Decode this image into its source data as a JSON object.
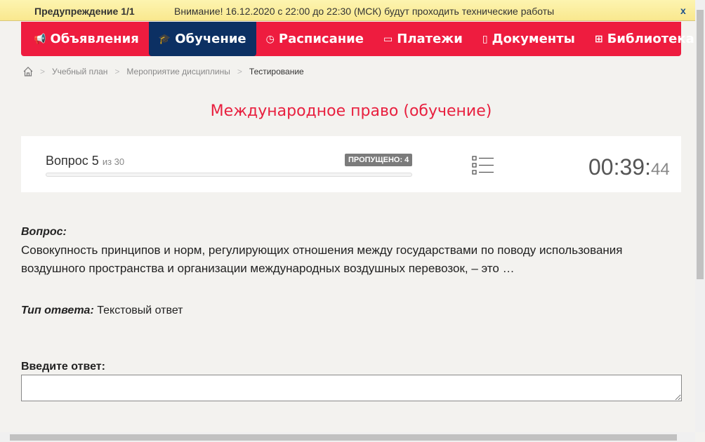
{
  "warning": {
    "title": "Предупреждение 1/1",
    "message": "Внимание! 16.12.2020 с 22:00 до 22:30 (МСК) будут проходить технические работы",
    "close": "x"
  },
  "nav": [
    {
      "label": "Объявления",
      "icon": "megaphone-icon",
      "glyph": "📢"
    },
    {
      "label": "Обучение",
      "icon": "graduation-cap-icon",
      "glyph": "🎓",
      "active": true
    },
    {
      "label": "Расписание",
      "icon": "clock-icon",
      "glyph": "◷"
    },
    {
      "label": "Платежи",
      "icon": "money-icon",
      "glyph": "▭"
    },
    {
      "label": "Документы",
      "icon": "document-icon",
      "glyph": "▯"
    },
    {
      "label": "Библиотека",
      "icon": "book-icon",
      "glyph": "⊞",
      "chevron": "⌄"
    }
  ],
  "breadcrumb": [
    "Учебный план",
    "Мероприятие дисциплины",
    "Тестирование"
  ],
  "page_title": "Международное право (обучение)",
  "test": {
    "question_label": "Вопрос 5",
    "of_label": "из 30",
    "progress": 0,
    "skipped": "ПРОПУЩЕНО: 4",
    "timer_main": "00:39:",
    "timer_sec": "44"
  },
  "question": {
    "heading": "Вопрос:",
    "text": "Совокупность принципов и норм, регулирующих отношения между государствами по поводу использования воздушного пространства и организации международных воздушных перевозок, – это …",
    "type_label": "Тип ответа:",
    "type_value": "Текстовый ответ",
    "answer_label": "Введите ответ:",
    "answer_value": ""
  },
  "colors": {
    "accent": "#ee1c3f",
    "active": "#0c3063"
  }
}
